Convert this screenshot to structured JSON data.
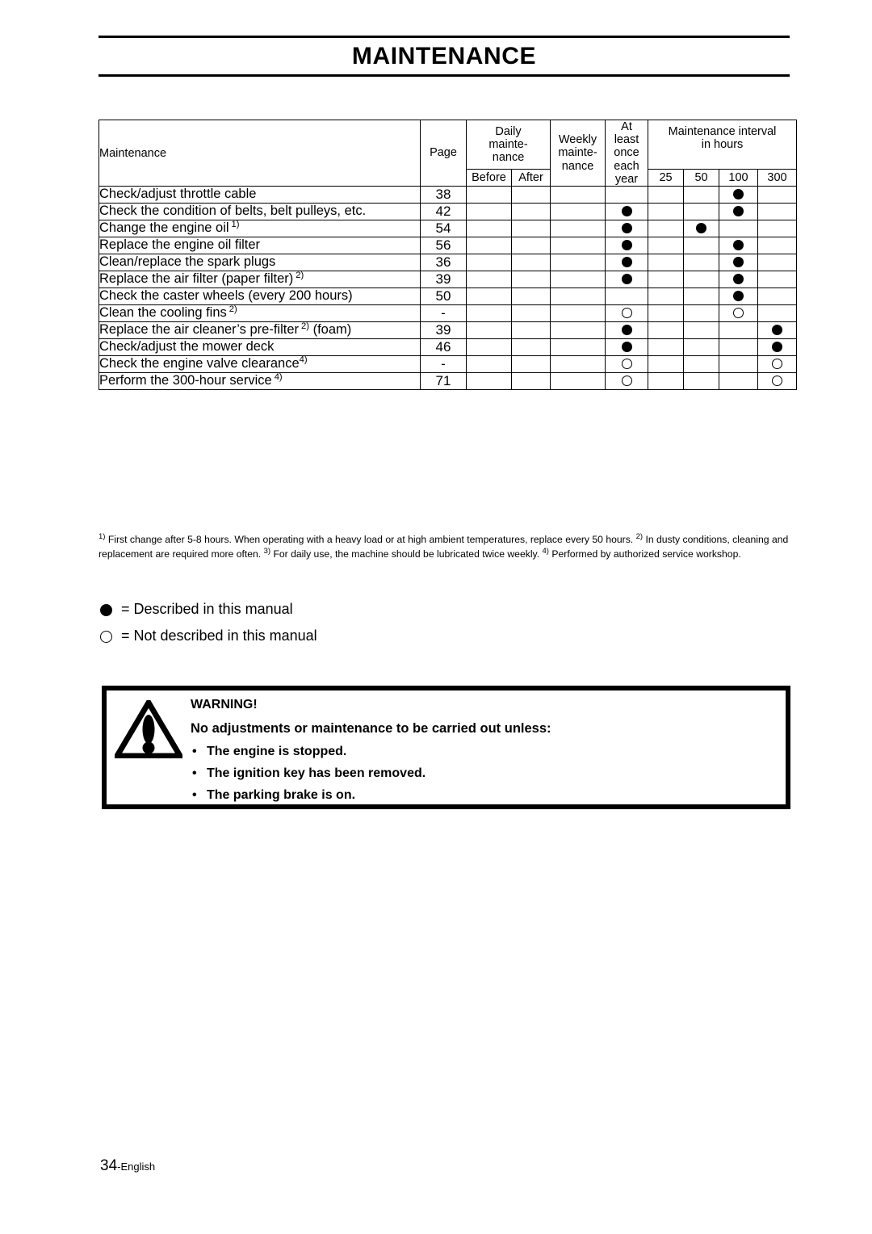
{
  "header": {
    "title": "MAINTENANCE"
  },
  "table": {
    "col_headers": {
      "maintenance": "Maintenance",
      "page": "Page",
      "daily": "Daily mainte- nance",
      "daily_before": "Before",
      "daily_after": "After",
      "weekly": "Weekly mainte- nance",
      "at_least": "At least once each year",
      "interval": "Maintenance interval in hours",
      "h25": "25",
      "h50": "50",
      "h100": "100",
      "h300": "300"
    },
    "rows": [
      {
        "task": "Check/adjust throttle cable",
        "footnote": "",
        "page": "38",
        "before": "",
        "after": "",
        "weekly": "",
        "year": "",
        "h25": "",
        "h50": "",
        "h100": "filled",
        "h300": ""
      },
      {
        "task": "Check the condition of belts, belt pulleys, etc.",
        "footnote": "",
        "page": "42",
        "before": "",
        "after": "",
        "weekly": "",
        "year": "filled",
        "h25": "",
        "h50": "",
        "h100": "filled",
        "h300": ""
      },
      {
        "task": "Change the engine oil",
        "footnote": "1)",
        "page": "54",
        "before": "",
        "after": "",
        "weekly": "",
        "year": "filled",
        "h25": "",
        "h50": "filled",
        "h100": "",
        "h300": ""
      },
      {
        "task": "Replace the engine oil filter",
        "footnote": "",
        "page": "56",
        "before": "",
        "after": "",
        "weekly": "",
        "year": "filled",
        "h25": "",
        "h50": "",
        "h100": "filled",
        "h300": ""
      },
      {
        "task": "Clean/replace the spark plugs",
        "footnote": "",
        "page": "36",
        "before": "",
        "after": "",
        "weekly": "",
        "year": "filled",
        "h25": "",
        "h50": "",
        "h100": "filled",
        "h300": ""
      },
      {
        "task": "Replace the air filter (paper filter)",
        "footnote": "2)",
        "page": "39",
        "before": "",
        "after": "",
        "weekly": "",
        "year": "filled",
        "h25": "",
        "h50": "",
        "h100": "filled",
        "h300": ""
      },
      {
        "task": "Check the caster wheels (every 200 hours)",
        "footnote": "",
        "page": "50",
        "before": "",
        "after": "",
        "weekly": "",
        "year": "",
        "h25": "",
        "h50": "",
        "h100": "filled",
        "h300": ""
      },
      {
        "task": "Clean the cooling fins",
        "footnote": "2)",
        "page": "-",
        "before": "",
        "after": "",
        "weekly": "",
        "year": "open",
        "h25": "",
        "h50": "",
        "h100": "open",
        "h300": ""
      },
      {
        "task": "Replace the air cleaner’s pre-filter",
        "footnote": "2)",
        "task_suffix": " (foam)",
        "page": "39",
        "before": "",
        "after": "",
        "weekly": "",
        "year": "filled",
        "h25": "",
        "h50": "",
        "h100": "",
        "h300": "filled"
      },
      {
        "task": "Check/adjust the mower deck",
        "footnote": "",
        "page": "46",
        "before": "",
        "after": "",
        "weekly": "",
        "year": "filled",
        "h25": "",
        "h50": "",
        "h100": "",
        "h300": "filled"
      },
      {
        "task": "Check the engine valve clearance",
        "footnote": "4)",
        "footnote_tight": true,
        "page": "-",
        "before": "",
        "after": "",
        "weekly": "",
        "year": "open",
        "h25": "",
        "h50": "",
        "h100": "",
        "h300": "open"
      },
      {
        "task": "Perform the 300-hour service",
        "footnote": "4)",
        "page": "71",
        "before": "",
        "after": "",
        "weekly": "",
        "year": "open",
        "h25": "",
        "h50": "",
        "h100": "",
        "h300": "open"
      }
    ]
  },
  "footnotes": {
    "n1_marker": "1)",
    "n1_text": "First change after 5-8 hours. When operating with a heavy load or at high ambient temperatures, replace every 50 hours.",
    "n2_marker": "2)",
    "n2_text": "In dusty conditions, cleaning and replacement are required more often.",
    "n3_marker": "3)",
    "n3_text": "For daily use, the machine should be lubricated twice weekly.",
    "n4_marker": "4)",
    "n4_text": "Performed by authorized service workshop."
  },
  "legend": {
    "filled_label": "= Described in this manual",
    "open_label": "= Not described in this manual"
  },
  "warning": {
    "title": "WARNING!",
    "lead": "No adjustments or maintenance to be carried out unless:",
    "bullet_glyph": "•",
    "items": [
      "The engine is stopped.",
      "The ignition key has been removed.",
      "The parking brake is on."
    ]
  },
  "footer": {
    "page_number": "34",
    "language": "-English"
  },
  "colors": {
    "ink": "#000000",
    "paper": "#ffffff"
  }
}
